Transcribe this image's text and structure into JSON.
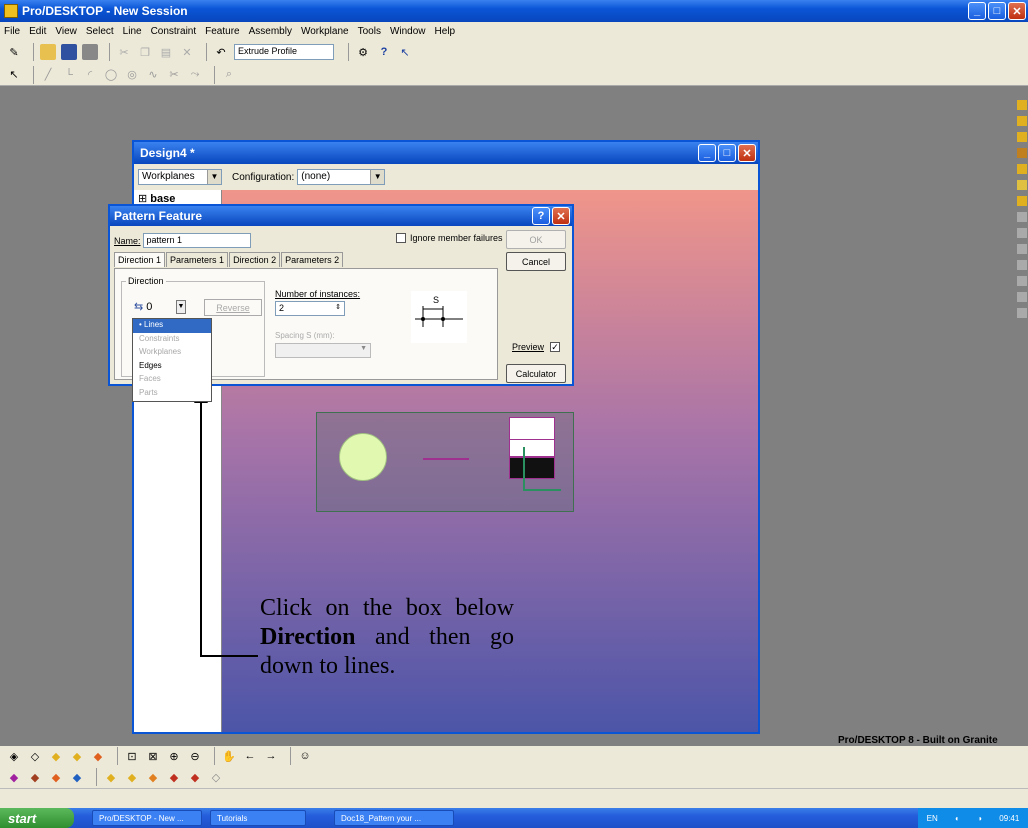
{
  "app": {
    "title": "Pro/DESKTOP - New Session",
    "product_label": "Pro/DESKTOP 8 - Built on Granite"
  },
  "menu": [
    "File",
    "Edit",
    "View",
    "Select",
    "Line",
    "Constraint",
    "Feature",
    "Assembly",
    "Workplane",
    "Tools",
    "Window",
    "Help"
  ],
  "toolbar": {
    "feature_field": "Extrude Profile"
  },
  "design": {
    "title": "Design4 *",
    "browser_select": "Workplanes",
    "config_label": "Configuration:",
    "config_value": "(none)",
    "tree_item": "base"
  },
  "dialog": {
    "title": "Pattern Feature",
    "name_label": "Name:",
    "name_value": "pattern 1",
    "ignore_label": "Ignore member failures",
    "ok_label": "OK",
    "cancel_label": "Cancel",
    "tabs": [
      "Direction 1",
      "Parameters 1",
      "Direction 2",
      "Parameters 2"
    ],
    "direction_group": "Direction",
    "direction_count": "0",
    "reverse_label": "Reverse",
    "instances_label": "Number of instances:",
    "instances_value": "2",
    "spacing_label": "Spacing S (mm):",
    "preview_label": "Preview",
    "calculator_label": "Calculator",
    "dropdown_items": [
      {
        "label": "• Lines",
        "state": "selected"
      },
      {
        "label": "Constraints",
        "state": "disabled"
      },
      {
        "label": "Workplanes",
        "state": "disabled"
      },
      {
        "label": "Edges",
        "state": "enabled"
      },
      {
        "label": "Faces",
        "state": "disabled"
      },
      {
        "label": "Parts",
        "state": "disabled"
      }
    ]
  },
  "annotation": {
    "part1": "Click on the box below",
    "bold": "Direction",
    "part2": "and then go down to lines."
  },
  "taskbar": {
    "start": "start",
    "items": [
      "Pro/DESKTOP - New ...",
      "Tutorials",
      "Doc18_Pattern your ..."
    ],
    "lang": "EN",
    "clock": "09:41"
  },
  "colors": {
    "title_blue": "#0a55d6",
    "canvas_top": "#f0958a",
    "canvas_bottom": "#4c55a8"
  }
}
